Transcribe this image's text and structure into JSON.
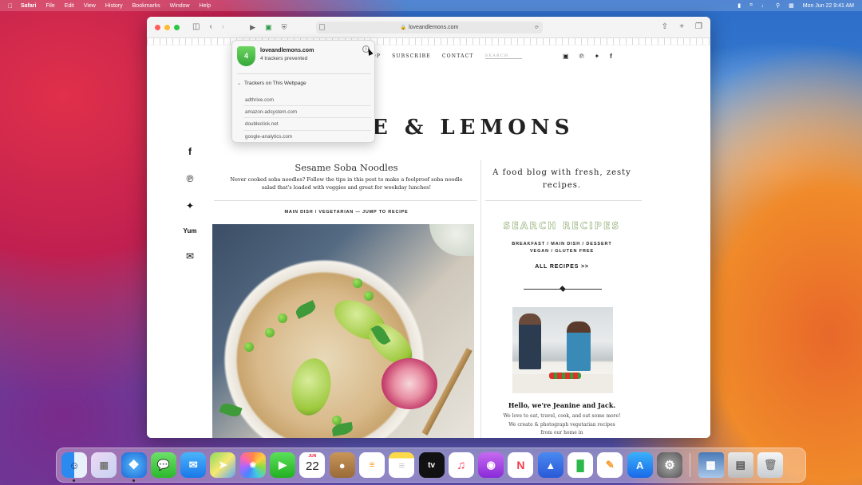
{
  "menubar": {
    "app_name": "Safari",
    "items": [
      "File",
      "Edit",
      "View",
      "History",
      "Bookmarks",
      "Window",
      "Help"
    ],
    "clock": "Mon Jun 22  9:41 AM"
  },
  "browser": {
    "address": "loveandlemons.com"
  },
  "site": {
    "nav": [
      "SHOP",
      "SUBSCRIBE",
      "CONTACT"
    ],
    "nav_search_placeholder": "SEARCH",
    "logo_visible": "E & LEMONS",
    "post_title": "Sesame Soba Noodles",
    "post_intro": "Never cooked soba noodles? Follow the tips in this post to make a foolproof soba noodle salad that's loaded with veggies and great for weekday lunches!",
    "post_categories": "MAIN DISH / VEGETARIAN — JUMP TO RECIPE",
    "tagline": "A food blog with fresh, zesty recipes.",
    "search_heading": "SEARCH RECIPES",
    "recipe_cats_line1": "BREAKFAST  /  MAIN DISH  /  DESSERT",
    "recipe_cats_line2": "VEGAN  /  GLUTEN FREE",
    "all_recipes": "ALL RECIPES >>",
    "hello": "Hello, we're Jeanine and Jack.",
    "about": "We love to eat, travel, cook, and eat some more! We create & photograph vegetarian recipes from our home in"
  },
  "popover": {
    "domain": "loveandlemons.com",
    "count_text": "4 trackers prevented",
    "section_title": "Trackers on This Webpage",
    "trackers": [
      "adthrive.com",
      "amazon-adsystem.com",
      "doubleclick.net",
      "google-analytics.com"
    ]
  },
  "dock": {
    "calendar_month": "JUN",
    "calendar_day": "22",
    "tv_label": "tv"
  }
}
